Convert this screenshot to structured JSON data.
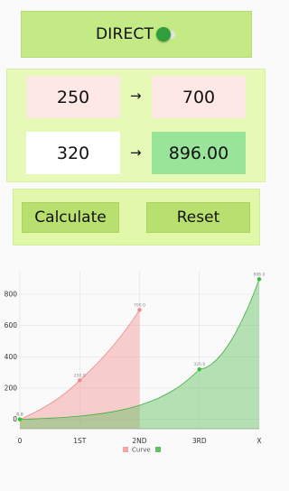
{
  "mode": {
    "label": "DIRECT",
    "toggle_on": true,
    "track_color": "#e4e4e4",
    "thumb_color": "#2f9e3b"
  },
  "inputs": {
    "row1": {
      "input": "250",
      "output": "700"
    },
    "row2": {
      "input": "320",
      "output": "896.00"
    },
    "arrow": "→",
    "colors": {
      "pink_field": "#fde8e6",
      "white_field": "#ffffff",
      "result_field": "#98e59a"
    }
  },
  "buttons": {
    "calculate": "Calculate",
    "reset": "Reset"
  },
  "chart_data": {
    "type": "area",
    "categories": [
      "0",
      "1ST",
      "2ND",
      "3RD",
      "X"
    ],
    "y_ticks": [
      "0",
      "200",
      "400",
      "600",
      "800"
    ],
    "ylim": [
      -60,
      950
    ],
    "grid": true,
    "legend_position": "bottom-center",
    "legend": "Curve",
    "series": [
      {
        "color": "#f4a5a5",
        "points": [
          {
            "x": 0,
            "y": 0.0,
            "label": "0.0"
          },
          {
            "x": 1,
            "y": 250.0,
            "label": "250.0"
          },
          {
            "x": 2,
            "y": 700.0,
            "label": "700.0"
          }
        ]
      },
      {
        "color": "#5fc15f",
        "points": [
          {
            "x": 0,
            "y": 0.0,
            "label": "0.0"
          },
          {
            "x": 3,
            "y": 320.0,
            "label": "320.0"
          },
          {
            "x": 4,
            "y": 896.0,
            "label": "896.0"
          }
        ]
      }
    ]
  }
}
